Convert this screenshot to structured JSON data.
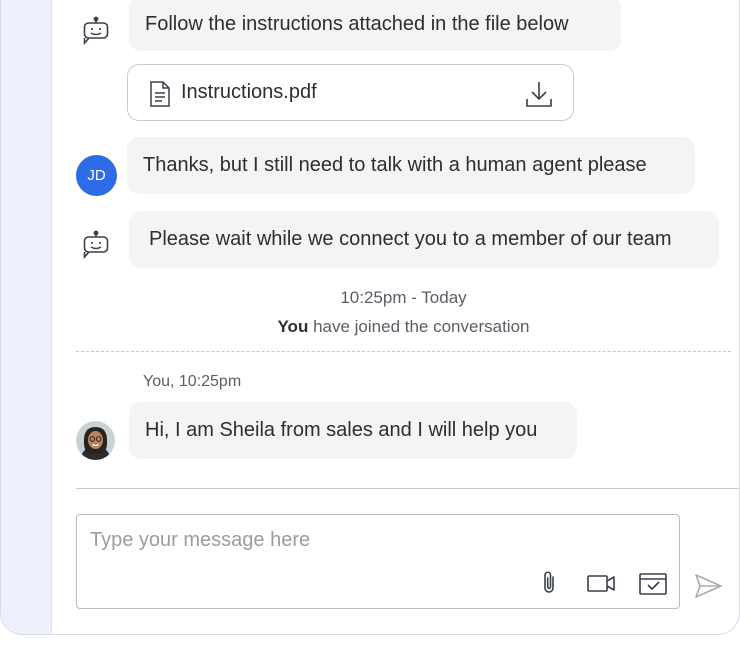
{
  "messages": {
    "bot_1": {
      "text": "Follow the instructions attached in the file below",
      "icon": "bot-icon"
    },
    "attachment": {
      "file_name": "Instructions.pdf",
      "file_icon": "document-icon",
      "action_icon": "download-icon"
    },
    "user_1": {
      "avatar_initials": "JD",
      "text": "Thanks, but I still need to talk with a human agent please"
    },
    "bot_2": {
      "text": "Please wait while we connect you to a member of our team",
      "icon": "bot-icon"
    },
    "agent_1": {
      "text": "Hi, I am Sheila from sales and I will help you",
      "avatar": "agent-photo"
    }
  },
  "system_notice": {
    "time": "10:25pm - Today",
    "joined_subject": "You",
    "joined_text": " have joined the conversation"
  },
  "agent_meta": "You, 10:25pm",
  "composer": {
    "placeholder": "Type your message here",
    "tools": [
      "attach-icon",
      "video-call-icon",
      "calendar-icon"
    ],
    "send_icon": "send-icon"
  },
  "colors": {
    "left_rail": "#eef0fd",
    "bubble": "#f4f4f5",
    "avatar_jd": "#2e6be6",
    "muted_text": "#5b5e66"
  }
}
